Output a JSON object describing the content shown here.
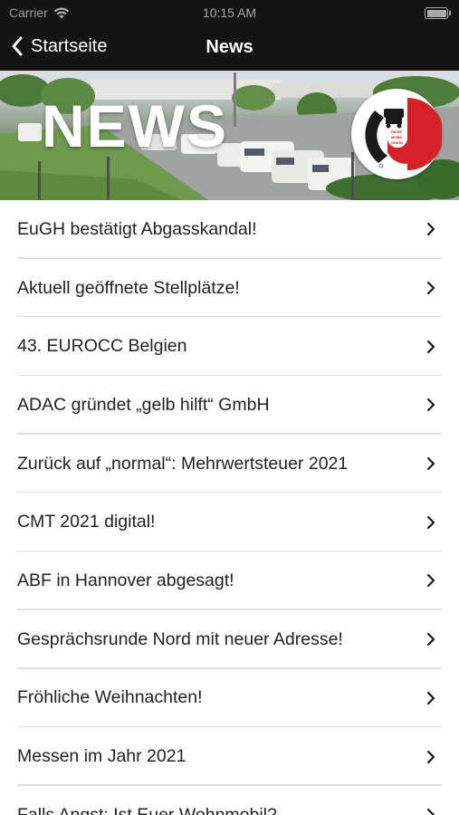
{
  "status_bar": {
    "carrier": "Carrier",
    "time": "10:15 AM",
    "icons": [
      "wifi-icon",
      "battery-icon"
    ]
  },
  "nav": {
    "back_label": "Startseite",
    "title": "News",
    "back_icon": "chevron-left-icon"
  },
  "banner": {
    "title": "NEWS",
    "logo_text": [
      "REISE",
      "MOBIL",
      "UNION"
    ],
    "colors": {
      "logo_red": "#d7212a",
      "logo_black": "#1a1a1a"
    }
  },
  "news": {
    "items": [
      {
        "label": "EuGH bestätigt Abgasskandal!"
      },
      {
        "label": "Aktuell geöffnete Stellplätze!"
      },
      {
        "label": "43. EUROCC Belgien"
      },
      {
        "label": "ADAC gründet „gelb hilft“ GmbH"
      },
      {
        "label": "Zurück auf „normal“: Mehrwertsteuer 2021"
      },
      {
        "label": "CMT 2021 digital!"
      },
      {
        "label": "ABF in Hannover abgesagt!"
      },
      {
        "label": "Gesprächsrunde Nord mit neuer Adresse!"
      },
      {
        "label": "Fröhliche Weihnachten!"
      },
      {
        "label": "Messen im Jahr 2021"
      },
      {
        "label": "Falls Angst: Ist Euer Wohnmobil?"
      }
    ]
  }
}
